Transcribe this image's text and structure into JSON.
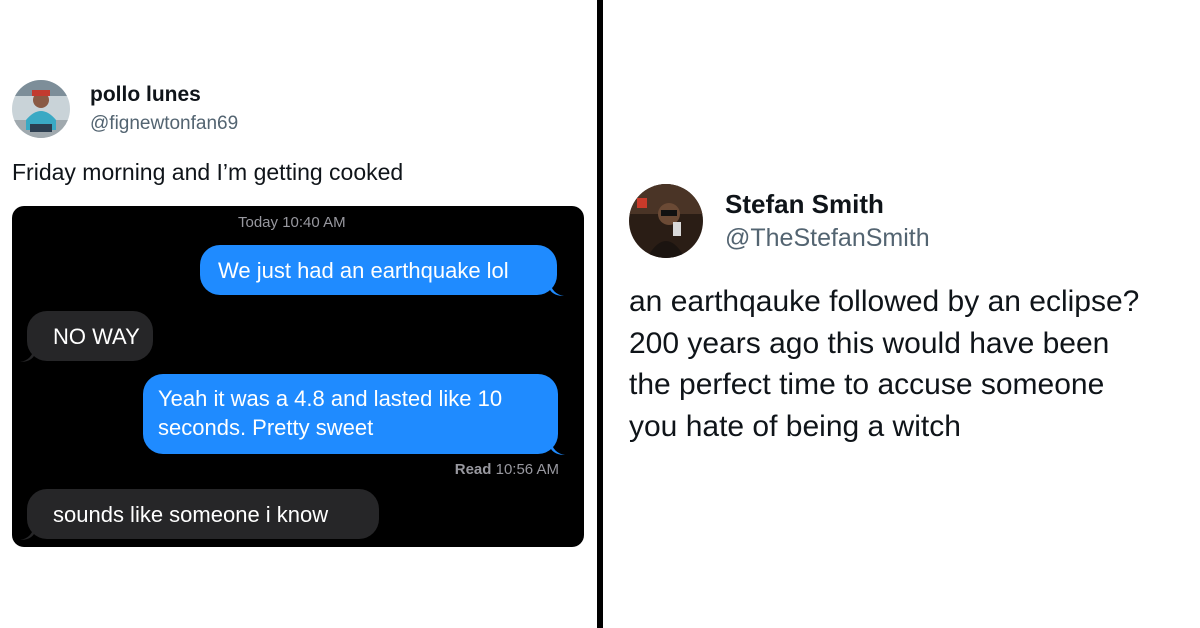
{
  "left_tweet": {
    "display_name": "pollo lunes",
    "handle": "@fignewtonfan69",
    "text": "Friday morning and I’m getting cooked",
    "avatar_icon": "profile-photo",
    "imessage": {
      "timestamp_top": "Today 10:40 AM",
      "messages": [
        {
          "direction": "outgoing",
          "text": "We just had an earthquake lol"
        },
        {
          "direction": "incoming",
          "text": "NO WAY"
        },
        {
          "direction": "outgoing",
          "text": "Yeah it was a 4.8 and lasted like 10 seconds. Pretty sweet"
        },
        {
          "direction": "incoming",
          "text": "sounds like someone i know"
        }
      ],
      "read_label": "Read",
      "read_time": "10:56 AM",
      "colors": {
        "outgoing": "#1f8bff",
        "incoming": "#262628",
        "background": "#000000"
      }
    }
  },
  "right_tweet": {
    "display_name": "Stefan Smith",
    "handle": "@TheStefanSmith",
    "avatar_icon": "profile-photo",
    "text_lines": [
      "an earthqauke followed by an eclipse?",
      "200 years ago this would have been",
      "the perfect time to accuse someone",
      "you hate of being a witch"
    ]
  }
}
